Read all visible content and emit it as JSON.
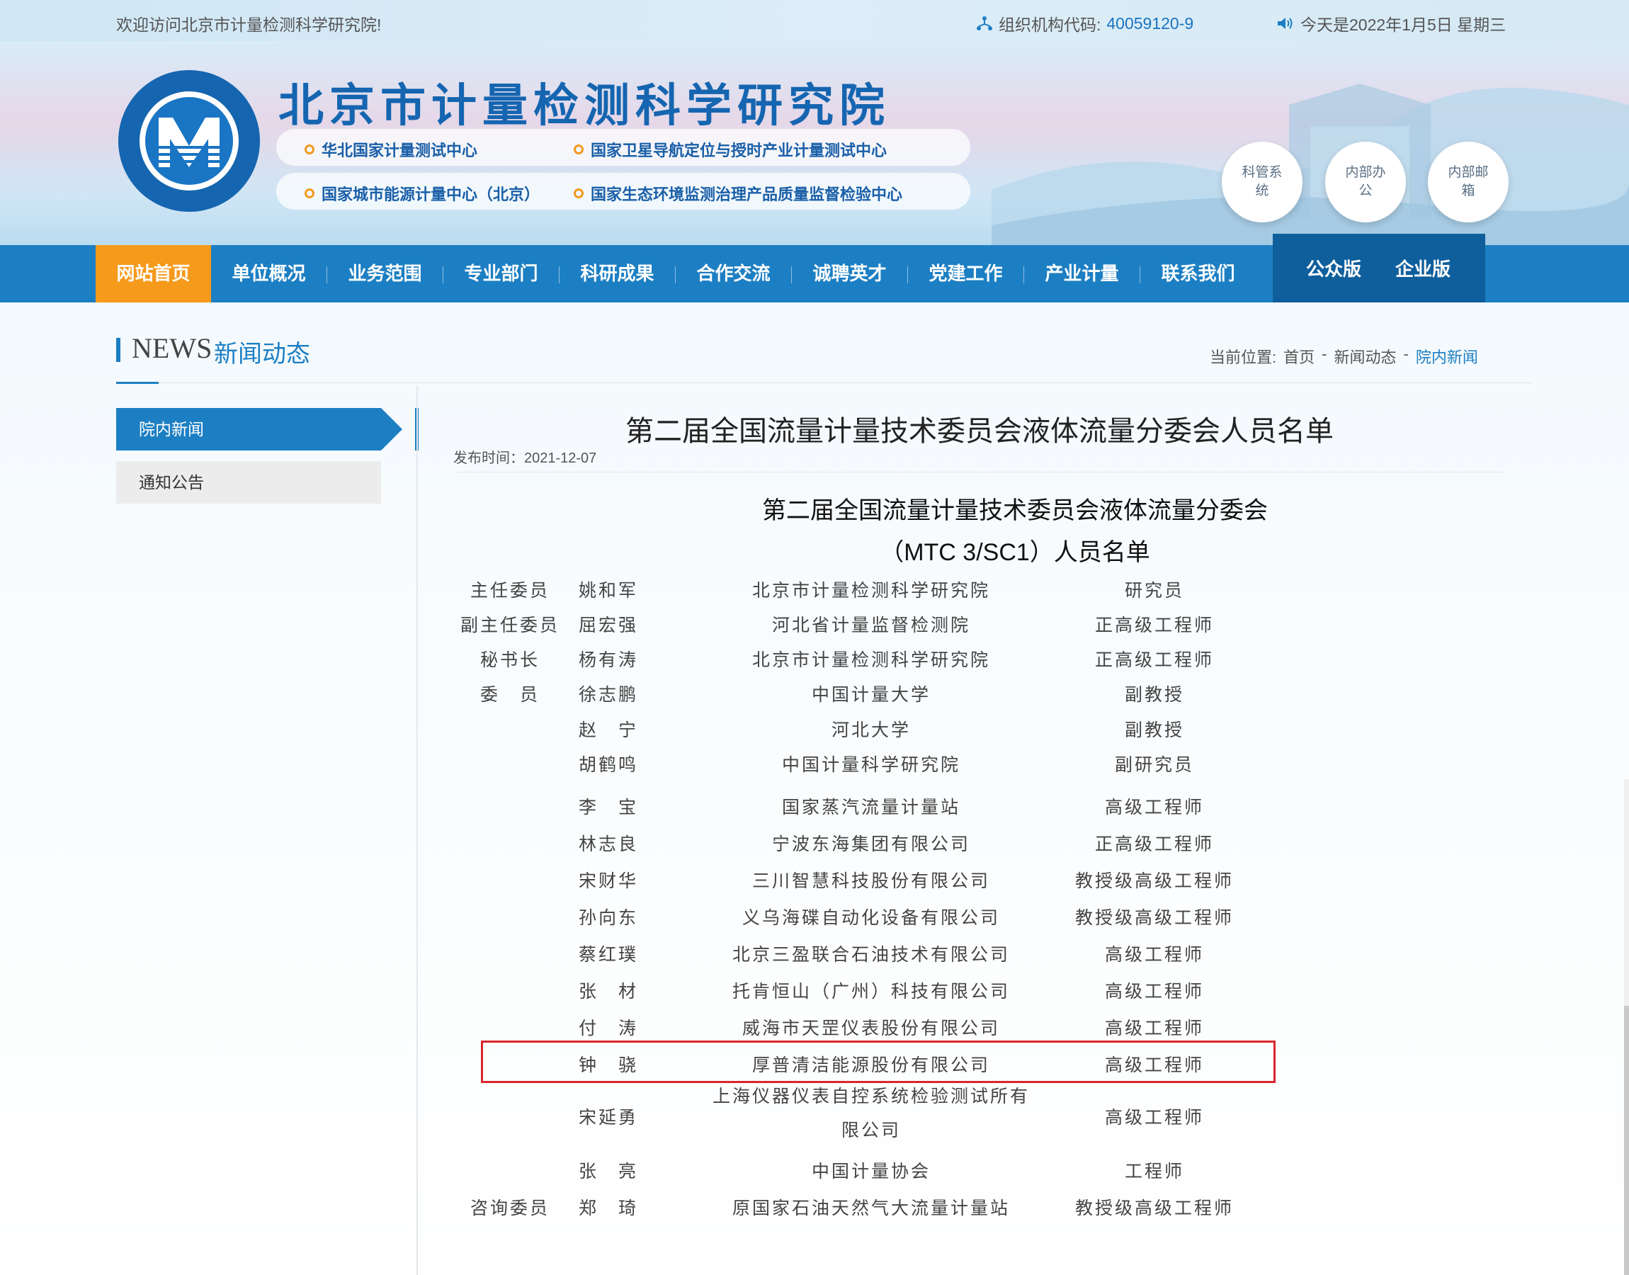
{
  "topbar": {
    "welcome": "欢迎访问北京市计量检测科学研究院!",
    "org_label": "组织机构代码:",
    "org_code": "40059120-9",
    "date": "今天是2022年1月5日 星期三"
  },
  "header": {
    "title": "北京市计量检测科学研究院",
    "centers": [
      "华北国家计量测试中心",
      "国家卫星导航定位与授时产业计量测试中心",
      "国家城市能源计量中心（北京）",
      "国家生态环境监测治理产品质量监督检验中心"
    ],
    "quick_links": [
      "科管系统",
      "内部办公",
      "内部邮箱"
    ]
  },
  "nav": {
    "items": [
      "网站首页",
      "单位概况",
      "业务范围",
      "专业部门",
      "科研成果",
      "合作交流",
      "诚聘英才",
      "党建工作",
      "产业计量",
      "联系我们"
    ],
    "versions": [
      "公众版",
      "企业版"
    ]
  },
  "section": {
    "en": "NEWS",
    "cn": "新闻动态",
    "crumb_label": "当前位置:",
    "crumb_home": "首页",
    "crumb_sep": "-",
    "crumb_mid": "新闻动态",
    "crumb_current": "院内新闻"
  },
  "sidebar": {
    "items": [
      "院内新闻",
      "通知公告"
    ]
  },
  "article": {
    "title": "第二届全国流量计量技术委员会液体流量分委会人员名单",
    "pubdate": "发布时间：2021-12-07",
    "heading1": "第二届全国流量计量技术委员会液体流量分委会",
    "heading2": "（MTC 3/SC1）人员名单",
    "rows": [
      {
        "role": "主任委员",
        "name": "姚和军",
        "org": "北京市计量检测科学研究院",
        "title": "研究员"
      },
      {
        "role": "副主任委员",
        "name": "屈宏强",
        "org": "河北省计量监督检测院",
        "title": "正高级工程师"
      },
      {
        "role": "秘书长",
        "name": "杨有涛",
        "org": "北京市计量检测科学研究院",
        "title": "正高级工程师"
      },
      {
        "role": "委　员",
        "name": "徐志鹏",
        "org": "中国计量大学",
        "title": "副教授"
      },
      {
        "role": "",
        "name": "赵　宁",
        "org": "河北大学",
        "title": "副教授"
      },
      {
        "role": "",
        "name": "胡鹤鸣",
        "org": "中国计量科学研究院",
        "title": "副研究员"
      },
      {
        "role": "",
        "name": "李　宝",
        "org": "国家蒸汽流量计量站",
        "title": "高级工程师"
      },
      {
        "role": "",
        "name": "林志良",
        "org": "宁波东海集团有限公司",
        "title": "正高级工程师"
      },
      {
        "role": "",
        "name": "宋财华",
        "org": "三川智慧科技股份有限公司",
        "title": "教授级高级工程师"
      },
      {
        "role": "",
        "name": "孙向东",
        "org": "义乌海碟自动化设备有限公司",
        "title": "教授级高级工程师"
      },
      {
        "role": "",
        "name": "蔡红璞",
        "org": "北京三盈联合石油技术有限公司",
        "title": "高级工程师"
      },
      {
        "role": "",
        "name": "张　材",
        "org": "托肯恒山（广州）科技有限公司",
        "title": "高级工程师"
      },
      {
        "role": "",
        "name": "付　涛",
        "org": "威海市天罡仪表股份有限公司",
        "title": "高级工程师"
      },
      {
        "role": "",
        "name": "钟　骁",
        "org": "厚普清洁能源股份有限公司",
        "title": "高级工程师"
      },
      {
        "role": "",
        "name": "宋延勇",
        "org": "上海仪器仪表自控系统检验测试所有限公司",
        "org_line1": "上海仪器仪表自控系统检验测试所有",
        "org_line2": "限公司",
        "title": "高级工程师"
      },
      {
        "role": "",
        "name": "张　亮",
        "org": "中国计量协会",
        "title": "工程师"
      },
      {
        "role": "咨询委员",
        "name": "郑　琦",
        "org": "原国家石油天然气大流量计量站",
        "title": "教授级高级工程师"
      }
    ]
  },
  "colors": {
    "primary": "#1d7fc3",
    "accent": "#f59a1b",
    "highlight_border": "#d9262c"
  }
}
